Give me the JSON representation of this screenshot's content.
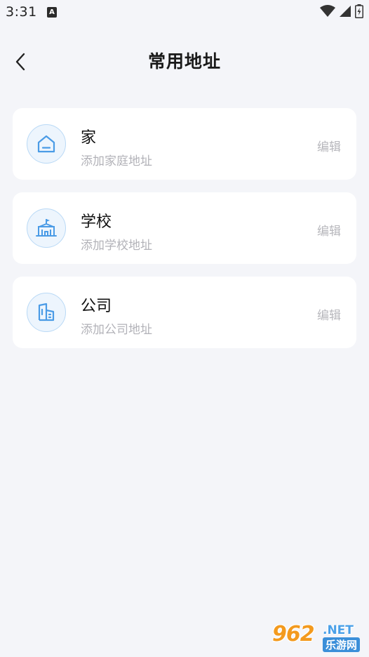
{
  "status": {
    "time": "3:31",
    "notification_icon": "a-icon"
  },
  "header": {
    "back_icon": "chevron-left-icon",
    "title": "常用地址"
  },
  "addresses": [
    {
      "title": "家",
      "subtitle": "添加家庭地址",
      "edit_label": "编辑",
      "icon": "home-icon"
    },
    {
      "title": "学校",
      "subtitle": "添加学校地址",
      "edit_label": "编辑",
      "icon": "school-icon"
    },
    {
      "title": "公司",
      "subtitle": "添加公司地址",
      "edit_label": "编辑",
      "icon": "office-building-icon"
    }
  ],
  "colors": {
    "background": "#f4f5f9",
    "card": "#ffffff",
    "icon_accent": "#4a9be6",
    "icon_bg": "#edf5fd",
    "muted_text": "#b2b2b8"
  },
  "watermark": {
    "number": "962",
    "net": ".NET",
    "cn": "乐游网"
  }
}
